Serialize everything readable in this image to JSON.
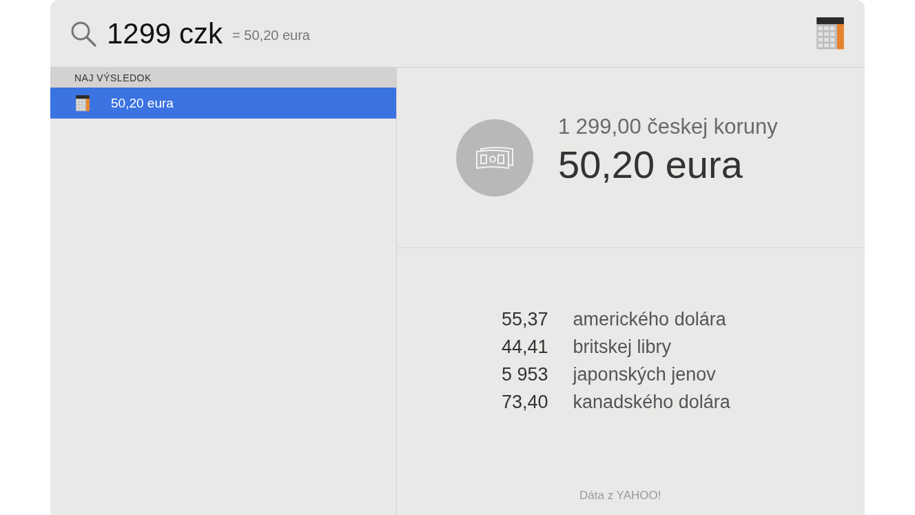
{
  "search": {
    "query": "1299 czk",
    "hint": "= 50,20 eura"
  },
  "sidebar": {
    "section": "NAJ VÝSLEDOK",
    "items": [
      {
        "label": "50,20 eura",
        "selected": true
      }
    ]
  },
  "result": {
    "source": "1 299,00 českej koruny",
    "value": "50,20 eura"
  },
  "rates": [
    {
      "amount": "55,37",
      "currency": "amerického dolára"
    },
    {
      "amount": "44,41",
      "currency": "britskej libry"
    },
    {
      "amount": "5 953",
      "currency": "japonských jenov"
    },
    {
      "amount": "73,40",
      "currency": "kanadského dolára"
    }
  ],
  "footer": "Dáta z YAHOO!"
}
